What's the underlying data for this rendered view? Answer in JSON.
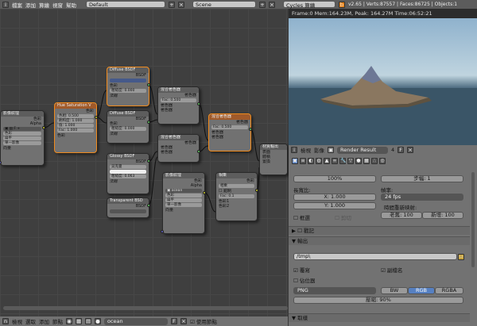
{
  "top_menu": {
    "items": [
      "檔案",
      "添加",
      "算繪",
      "視窗",
      "幫助"
    ],
    "layout": "Default",
    "scene": "Scene",
    "engine": "Cycles 算繪",
    "stats": "v2.65 | Verts:87557 | Faces:86725 | Objects:1"
  },
  "render": {
    "info": "Frame:0 Mem:164.23M, Peak: 164.27M Time:06:52:21"
  },
  "image_header": {
    "view": "檢視",
    "image": "影像",
    "result": "Render Result",
    "slot": "4",
    "f_label": "F"
  },
  "nodes": {
    "img_tex1": {
      "title": "影像紋理",
      "color": "色彩",
      "alpha": "Alpha",
      "c1": "色彩",
      "c2": "扁平",
      "c3": "單一影像",
      "vector": "向量"
    },
    "hue_sat": {
      "title": "Hue Saturation V",
      "color": "色彩",
      "hue": "色相: 0.500",
      "sat": "飽和度: 1.000",
      "val": "值: 1.000",
      "fac": "Fac: 1.000",
      "in": "色彩"
    },
    "diffuse1": {
      "title": "Diffuse BSDF",
      "bsdf": "BSDF",
      "color": "色彩",
      "rough": "粗糙度: 0.000",
      "normal": "法線"
    },
    "diffuse2": {
      "title": "Diffuse BSDF",
      "bsdf": "BSDF",
      "color": "色彩",
      "rough": "粗糙度: 0.000",
      "normal": "法線"
    },
    "glossy": {
      "title": "Glossy BSDF",
      "bsdf": "BSDF",
      "mode": "貝克曼",
      "color": "色彩",
      "rough": "粗糙度: 0.063",
      "normal": "法線"
    },
    "transparent": {
      "title": "Transparent BSD",
      "bsdf": "BSDF",
      "color": "色彩"
    },
    "mix1": {
      "title": "混合著色器",
      "out": "著色器",
      "fac": "Fac: 0.500",
      "s1": "著色器",
      "s2": "著色器"
    },
    "mix2": {
      "title": "混合著色器",
      "out": "著色器",
      "s1": "著色器",
      "s2": "著色器"
    },
    "mix3": {
      "title": "混合著色器",
      "out": "著色器",
      "fac": "Fac: 0.500",
      "s1": "著色器",
      "s2": "著色器"
    },
    "img_tex2": {
      "title": "影像紋理",
      "color": "色彩",
      "alpha": "Alpha",
      "file": "ocean",
      "c1": "色彩",
      "c2": "扁平",
      "c3": "單一影像",
      "vector": "向量"
    },
    "mix_rgb": {
      "title": "相乘",
      "color": "色彩",
      "mode": "相乘",
      "clamp": "鉗制",
      "fac": "Fac: 0.1",
      "c1": "色彩1",
      "c2": "色彩2"
    },
    "output": {
      "title": "材質輸出",
      "surf": "表面",
      "vol": "體積",
      "disp": "置換"
    }
  },
  "node_footer": {
    "view": "檢視",
    "select": "選取",
    "add": "添加",
    "node": "節點",
    "material": "ocean",
    "f_label": "F",
    "use_nodes": "使用節點"
  },
  "props": {
    "top_left": "100%",
    "top_right": "步幅: 1",
    "aspect_label": "長寬比:",
    "x": "X: 1.000",
    "y": "Y: 1.000",
    "fps_label": "幀率:",
    "fps": "24 fps",
    "remap_label": "時間重新映射:",
    "old": "老舊: 100",
    "new": "新增: 100",
    "border": "框選",
    "crop": "剪切",
    "stamp": "戳記",
    "output": "輸出",
    "path": "/tmp\\",
    "overwrite": "覆寫",
    "extension": "副檔名",
    "placeholder": "佔位器",
    "format": "PNG",
    "bw": "BW",
    "rgb": "RGB",
    "rgba": "RGBA",
    "compression": "壓縮: 90%",
    "sampling": "取樣"
  },
  "colors": {
    "selected": "#f08a1c",
    "accent": "#5680c2",
    "shader_socket": "#63c763",
    "color_socket": "#c7c729",
    "vector_socket": "#6363c7",
    "value_socket": "#a1a1a1"
  }
}
